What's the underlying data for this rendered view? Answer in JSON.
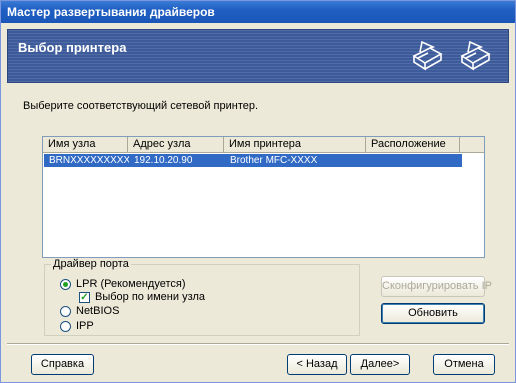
{
  "window": {
    "title": "Мастер развертывания драйверов"
  },
  "header": {
    "title": "Выбор принтера",
    "icons": [
      "printer-icon",
      "printer-icon"
    ]
  },
  "prompt": "Выберите соответствующий сетевой принтер.",
  "printer_list": {
    "columns": [
      "Имя узла",
      "Адрес узла",
      "Имя принтера",
      "Расположение"
    ],
    "rows": [
      {
        "node_name": "BRNXXXXXXXXX",
        "node_address": "192.10.20.90",
        "printer_name": "Brother MFC-XXXX",
        "location": ""
      }
    ],
    "selected_row": 0
  },
  "port_driver": {
    "legend": "Драйвер порта",
    "options": [
      {
        "label": "LPR (Рекомендуется)",
        "checked": true
      },
      {
        "label": "NetBIOS",
        "checked": false
      },
      {
        "label": "IPP",
        "checked": false
      }
    ],
    "select_by_node_name": {
      "label": "Выбор по имени узла",
      "checked": true
    }
  },
  "buttons": {
    "configure_ip": "Сконфигурировать IP",
    "refresh": "Обновить",
    "help": "Справка",
    "back": "< Назад",
    "next": "Далее>",
    "cancel": "Отмена"
  },
  "colors": {
    "title_bar": "#1f5fc4",
    "header_band": "#3d5b9b",
    "selection": "#316ac5",
    "dialog_bg": "#ece9d8"
  }
}
